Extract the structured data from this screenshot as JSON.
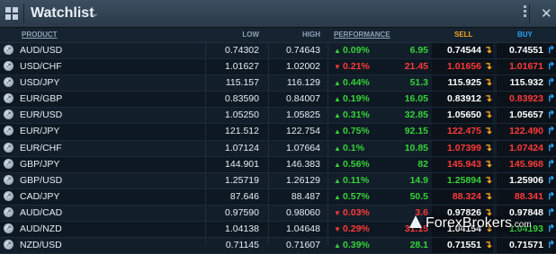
{
  "window": {
    "title": "Watchlist"
  },
  "header": {
    "product": "PRODUCT",
    "low": "LOW",
    "high": "HIGH",
    "performance": "PERFORMANCE",
    "sell": "SELL",
    "buy": "BUY"
  },
  "rows": [
    {
      "symbol": "AUD/USD",
      "low": "0.74302",
      "high": "0.74643",
      "perf": "0.09%",
      "dir": "up",
      "pips": "6.95",
      "sell": "0.74544",
      "buy": "0.74551",
      "color": "neutral"
    },
    {
      "symbol": "USD/CHF",
      "low": "1.01627",
      "high": "1.02002",
      "perf": "0.21%",
      "dir": "down",
      "pips": "21.45",
      "sell": "1.01656",
      "buy": "1.01671",
      "color": "down"
    },
    {
      "symbol": "USD/JPY",
      "low": "115.157",
      "high": "116.129",
      "perf": "0.44%",
      "dir": "up",
      "pips": "51.3",
      "sell": "115.925",
      "buy": "115.932",
      "color": "neutral"
    },
    {
      "symbol": "EUR/GBP",
      "low": "0.83590",
      "high": "0.84007",
      "perf": "0.19%",
      "dir": "up",
      "pips": "16.05",
      "sell": "0.83912",
      "buy": "0.83923",
      "color": "buydown"
    },
    {
      "symbol": "EUR/USD",
      "low": "1.05250",
      "high": "1.05825",
      "perf": "0.31%",
      "dir": "up",
      "pips": "32.85",
      "sell": "1.05650",
      "buy": "1.05657",
      "color": "neutral"
    },
    {
      "symbol": "EUR/JPY",
      "low": "121.512",
      "high": "122.754",
      "perf": "0.75%",
      "dir": "up",
      "pips": "92.15",
      "sell": "122.475",
      "buy": "122.490",
      "color": "down"
    },
    {
      "symbol": "EUR/CHF",
      "low": "1.07124",
      "high": "1.07664",
      "perf": "0.1%",
      "dir": "up",
      "pips": "10.85",
      "sell": "1.07399",
      "buy": "1.07424",
      "color": "down"
    },
    {
      "symbol": "GBP/JPY",
      "low": "144.901",
      "high": "146.383",
      "perf": "0.56%",
      "dir": "up",
      "pips": "82",
      "sell": "145.943",
      "buy": "145.968",
      "color": "down"
    },
    {
      "symbol": "GBP/USD",
      "low": "1.25719",
      "high": "1.26129",
      "perf": "0.11%",
      "dir": "up",
      "pips": "14.9",
      "sell": "1.25894",
      "buy": "1.25906",
      "color": "sellup"
    },
    {
      "symbol": "CAD/JPY",
      "low": "87.646",
      "high": "88.487",
      "perf": "0.57%",
      "dir": "up",
      "pips": "50.5",
      "sell": "88.324",
      "buy": "88.341",
      "color": "down"
    },
    {
      "symbol": "AUD/CAD",
      "low": "0.97590",
      "high": "0.98060",
      "perf": "0.03%",
      "dir": "down",
      "pips": "3.6",
      "sell": "0.97826",
      "buy": "0.97848",
      "color": "neutral"
    },
    {
      "symbol": "AUD/NZD",
      "low": "1.04138",
      "high": "1.04648",
      "perf": "0.29%",
      "dir": "down",
      "pips": "31.15",
      "sell": "1.04154",
      "buy": "1.04193",
      "color": "buyup"
    },
    {
      "symbol": "NZD/USD",
      "low": "0.71145",
      "high": "0.71607",
      "perf": "0.39%",
      "dir": "up",
      "pips": "28.1",
      "sell": "0.71551",
      "buy": "0.71571",
      "color": "neutral"
    }
  ],
  "watermark": {
    "brand": "ForexBrokers",
    "suffix": ".com"
  },
  "colors": {
    "up": "#37d23a",
    "down": "#ff3a3a",
    "sell": "#f5a623",
    "buy": "#27a3f5"
  }
}
